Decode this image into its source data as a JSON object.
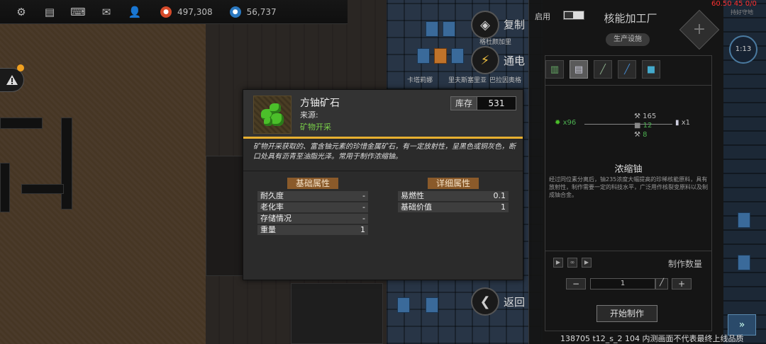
{
  "topbar": {
    "icons": [
      "gear-icon",
      "chat-icon",
      "keyboard-icon",
      "mail-icon",
      "person-icon"
    ],
    "resource1": "497,308",
    "resource2": "56,737"
  },
  "side_buttons": {
    "copy_label": "复制",
    "copy_sub": "格杜颜加里",
    "power_label": "通电",
    "names": [
      "卡塔莉娜",
      "里夫斯塞里亚",
      "巴拉因奥格"
    ],
    "back_label": "返回"
  },
  "panel": {
    "enable_label": "启用",
    "title": "核能加工厂",
    "subtitle": "生产设施",
    "input_qty": "x96",
    "tool1": "165",
    "tool2": "12",
    "tool3": "8",
    "output_qty": "x1",
    "product_name": "浓缩铀",
    "product_desc": "经过同位素分离后，铀235浓度大幅提高的珍稀核能原料，具有放射性，制作需要一定的科技水平，广泛用作核裂变原料以及制成铀合金。",
    "qty_label": "制作数量",
    "qty_value": "1",
    "start_label": "开始制作",
    "minus": "−",
    "plus": "+"
  },
  "hud": {
    "fps": "60.50 45 0/0",
    "fps_sub": "持好守地",
    "clock": "1:13"
  },
  "item": {
    "name": "方铀矿石",
    "source_label": "来源:",
    "source": "矿物开采",
    "stock_label": "库存",
    "stock": "531",
    "description": "矿物开采获取的、富含铀元素的珍惜金属矿石，有一定放射性，呈黑色或铜灰色，断口处具有沥青至油脂光泽。常用于制作浓缩铀。",
    "basic_title": "基础属性",
    "detail_title": "详细属性",
    "basic": [
      {
        "k": "耐久度",
        "v": "-"
      },
      {
        "k": "老化率",
        "v": "-"
      },
      {
        "k": "存储情况",
        "v": "-"
      },
      {
        "k": "重量",
        "v": "1"
      }
    ],
    "detail": [
      {
        "k": "易燃性",
        "v": "0.1"
      },
      {
        "k": "基础价值",
        "v": "1"
      }
    ]
  },
  "footer": "138705 t12_s_2 104  内测画面不代表最终上线品质"
}
